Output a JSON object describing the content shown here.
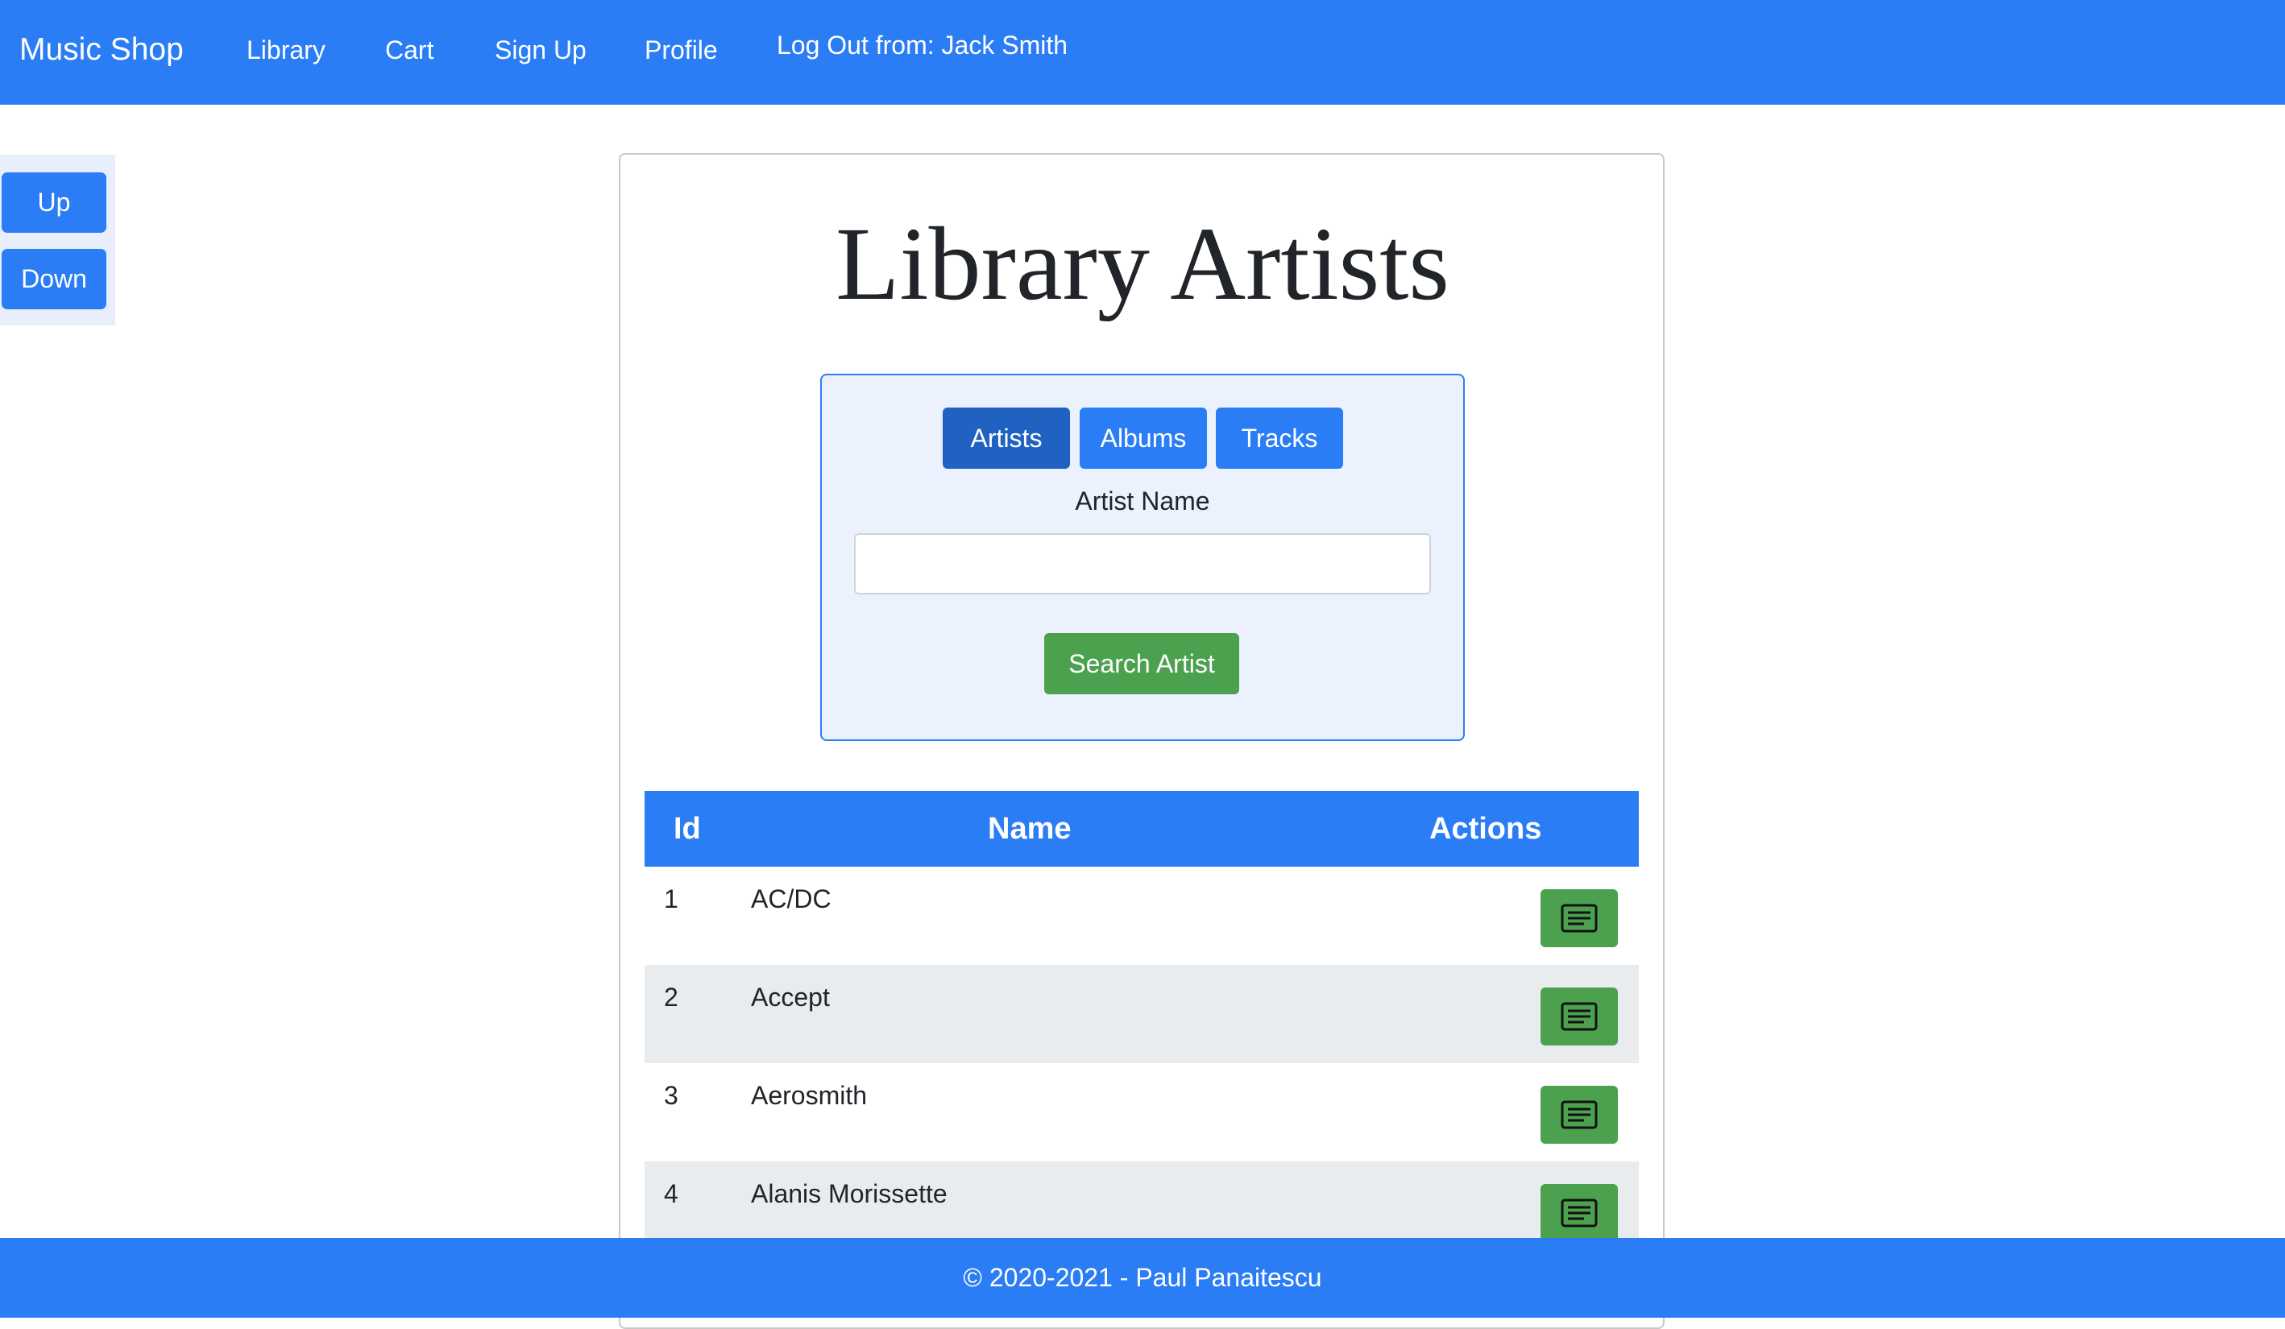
{
  "navbar": {
    "brand": "Music Shop",
    "links": [
      "Library",
      "Cart",
      "Sign Up",
      "Profile"
    ],
    "logout": "Log Out from: Jack Smith"
  },
  "side_buttons": {
    "up": "Up",
    "down": "Down"
  },
  "main": {
    "title": "Library Artists",
    "search": {
      "tabs": [
        "Artists",
        "Albums",
        "Tracks"
      ],
      "active_tab": "Artists",
      "field_label": "Artist Name",
      "field_value": "",
      "submit_label": "Search Artist"
    },
    "table": {
      "headers": [
        "Id",
        "Name",
        "Actions"
      ],
      "rows": [
        {
          "id": "1",
          "name": "AC/DC",
          "action_icon": "list-details-icon"
        },
        {
          "id": "2",
          "name": "Accept",
          "action_icon": "list-details-icon"
        },
        {
          "id": "3",
          "name": "Aerosmith",
          "action_icon": "list-details-icon"
        },
        {
          "id": "4",
          "name": "Alanis Morissette",
          "action_icon": "list-details-icon"
        }
      ]
    }
  },
  "footer": {
    "text": "© 2020-2021 - Paul Panaitescu"
  },
  "colors": {
    "primary": "#2b7df6",
    "primary_active": "#1f62c2",
    "success": "#4ca14f",
    "search_panel_bg": "#ebf1fd",
    "striped_row": "#e9ecef"
  }
}
